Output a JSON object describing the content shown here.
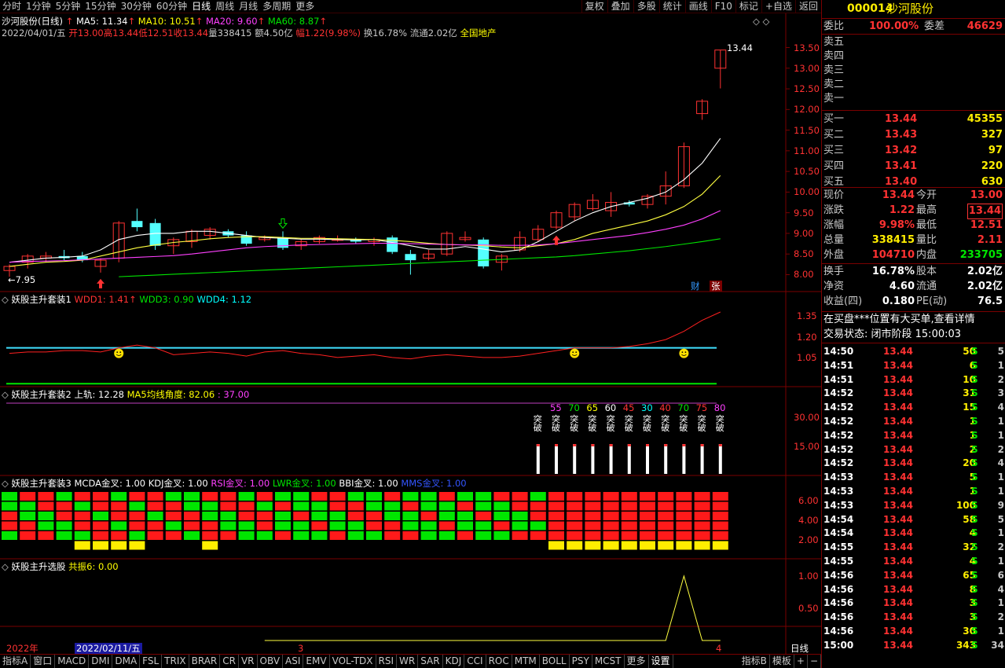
{
  "topbar": {
    "periods": [
      "分时",
      "1分钟",
      "5分钟",
      "15分钟",
      "30分钟",
      "60分钟",
      "日线",
      "周线",
      "月线",
      "多周期",
      "更多"
    ],
    "active": "日线",
    "tools": [
      "复权",
      "叠加",
      "多股",
      "统计",
      "画线",
      "F10",
      "标记",
      "+自选",
      "返回"
    ]
  },
  "main": {
    "title": "沙河股份(日线)",
    "ma5": "MA5: 11.34",
    "ma10": "MA10: 10.51",
    "ma20": "MA20: 9.60",
    "ma60": "MA60: 8.87",
    "info_date": "2022/04/01/五",
    "info_open": "开13.00",
    "info_high": "高13.44",
    "info_low": "低12.51",
    "info_close": "收13.44",
    "info_vol": "量338415",
    "info_amt": "额4.50亿",
    "info_pct": "幅1.22(9.98%)",
    "info_turn": "换16.78%",
    "info_float": "流通2.02亿",
    "info_sector": "全国地产",
    "y_ticks": [
      "13.50",
      "13.00",
      "12.50",
      "12.00",
      "11.50",
      "11.00",
      "10.50",
      "10.00",
      "9.50",
      "9.00",
      "8.50",
      "8.00"
    ],
    "high_label": "13.44",
    "low_label": "7.95",
    "badge_cai": "财",
    "badge_zhang": "张"
  },
  "chart_data": [
    {
      "type": "candlestick",
      "title": "沙河股份(日线)",
      "ylim": [
        7.8,
        13.7
      ],
      "candles": [
        {
          "o": 8.1,
          "h": 8.25,
          "l": 7.95,
          "c": 8.2
        },
        {
          "o": 8.3,
          "h": 8.5,
          "l": 8.15,
          "c": 8.45
        },
        {
          "o": 8.4,
          "h": 8.55,
          "l": 8.3,
          "c": 8.45
        },
        {
          "o": 8.45,
          "h": 8.6,
          "l": 8.35,
          "c": 8.4
        },
        {
          "o": 8.45,
          "h": 8.55,
          "l": 8.3,
          "c": 8.35
        },
        {
          "o": 8.2,
          "h": 8.4,
          "l": 8.05,
          "c": 8.35
        },
        {
          "o": 8.4,
          "h": 9.3,
          "l": 8.3,
          "c": 9.25
        },
        {
          "o": 9.3,
          "h": 9.6,
          "l": 9.05,
          "c": 9.15
        },
        {
          "o": 9.25,
          "h": 9.35,
          "l": 8.6,
          "c": 8.7
        },
        {
          "o": 8.7,
          "h": 8.9,
          "l": 8.5,
          "c": 8.85
        },
        {
          "o": 8.8,
          "h": 9.1,
          "l": 8.65,
          "c": 9.05
        },
        {
          "o": 8.95,
          "h": 9.15,
          "l": 8.85,
          "c": 9.1
        },
        {
          "o": 9.05,
          "h": 9.1,
          "l": 8.9,
          "c": 8.95
        },
        {
          "o": 8.95,
          "h": 9.05,
          "l": 8.7,
          "c": 8.75
        },
        {
          "o": 8.85,
          "h": 8.95,
          "l": 8.8,
          "c": 8.9
        },
        {
          "o": 8.9,
          "h": 9.05,
          "l": 8.6,
          "c": 8.65
        },
        {
          "o": 8.7,
          "h": 8.85,
          "l": 8.6,
          "c": 8.8
        },
        {
          "o": 8.8,
          "h": 8.95,
          "l": 8.75,
          "c": 8.9
        },
        {
          "o": 8.85,
          "h": 8.95,
          "l": 8.8,
          "c": 8.85
        },
        {
          "o": 8.85,
          "h": 8.9,
          "l": 8.75,
          "c": 8.8
        },
        {
          "o": 8.8,
          "h": 8.9,
          "l": 8.7,
          "c": 8.85
        },
        {
          "o": 8.9,
          "h": 8.95,
          "l": 8.5,
          "c": 8.55
        },
        {
          "o": 8.5,
          "h": 8.6,
          "l": 8.0,
          "c": 8.35
        },
        {
          "o": 8.4,
          "h": 8.6,
          "l": 8.35,
          "c": 8.5
        },
        {
          "o": 8.5,
          "h": 9.05,
          "l": 8.45,
          "c": 9.0
        },
        {
          "o": 8.85,
          "h": 9.05,
          "l": 8.8,
          "c": 8.9
        },
        {
          "o": 8.85,
          "h": 8.9,
          "l": 8.15,
          "c": 8.2
        },
        {
          "o": 8.3,
          "h": 8.5,
          "l": 8.1,
          "c": 8.45
        },
        {
          "o": 8.6,
          "h": 9.05,
          "l": 8.55,
          "c": 8.9
        },
        {
          "o": 8.85,
          "h": 9.2,
          "l": 8.8,
          "c": 9.1
        },
        {
          "o": 9.15,
          "h": 9.55,
          "l": 9.1,
          "c": 9.5
        },
        {
          "o": 9.4,
          "h": 9.75,
          "l": 9.3,
          "c": 9.7
        },
        {
          "o": 9.6,
          "h": 9.95,
          "l": 9.55,
          "c": 9.8
        },
        {
          "o": 9.55,
          "h": 10.0,
          "l": 9.4,
          "c": 9.75
        },
        {
          "o": 9.75,
          "h": 9.8,
          "l": 9.65,
          "c": 9.7
        },
        {
          "o": 9.7,
          "h": 9.95,
          "l": 9.6,
          "c": 9.9
        },
        {
          "o": 9.9,
          "h": 10.5,
          "l": 9.7,
          "c": 10.15
        },
        {
          "o": 10.15,
          "h": 11.2,
          "l": 10.1,
          "c": 11.1
        },
        {
          "o": 11.9,
          "h": 12.25,
          "l": 11.75,
          "c": 12.2
        },
        {
          "o": 13.0,
          "h": 13.44,
          "l": 12.51,
          "c": 13.44
        }
      ],
      "ma5": [
        8.3,
        8.35,
        8.4,
        8.42,
        8.45,
        8.6,
        8.85,
        8.95,
        9.0,
        9.0,
        9.05,
        9.05,
        9.0,
        8.95,
        8.9,
        8.88,
        8.86,
        8.86,
        8.85,
        8.84,
        8.85,
        8.78,
        8.7,
        8.62,
        8.62,
        8.68,
        8.62,
        8.55,
        8.6,
        8.8,
        9.05,
        9.3,
        9.5,
        9.65,
        9.75,
        9.85,
        10.0,
        10.3,
        10.7,
        11.3
      ],
      "ma10": [
        8.2,
        8.25,
        8.3,
        8.32,
        8.35,
        8.45,
        8.55,
        8.65,
        8.72,
        8.78,
        8.82,
        8.87,
        8.9,
        8.92,
        8.92,
        8.9,
        8.88,
        8.88,
        8.87,
        8.86,
        8.85,
        8.83,
        8.8,
        8.76,
        8.73,
        8.72,
        8.7,
        8.67,
        8.65,
        8.7,
        8.75,
        8.85,
        9.0,
        9.1,
        9.2,
        9.3,
        9.45,
        9.65,
        9.95,
        10.4
      ],
      "ma20": [
        8.3,
        8.32,
        8.33,
        8.34,
        8.36,
        8.38,
        8.4,
        8.42,
        8.44,
        8.46,
        8.5,
        8.55,
        8.6,
        8.65,
        8.68,
        8.7,
        8.72,
        8.73,
        8.74,
        8.75,
        8.76,
        8.76,
        8.75,
        8.74,
        8.73,
        8.72,
        8.72,
        8.71,
        8.71,
        8.72,
        8.75,
        8.8,
        8.85,
        8.9,
        8.95,
        9.02,
        9.1,
        9.2,
        9.35,
        9.55
      ],
      "ma60": [
        null,
        null,
        null,
        null,
        null,
        null,
        7.95,
        7.97,
        7.99,
        8.01,
        8.03,
        8.05,
        8.07,
        8.09,
        8.11,
        8.13,
        8.15,
        8.17,
        8.19,
        8.21,
        8.23,
        8.25,
        8.27,
        8.29,
        8.31,
        8.33,
        8.35,
        8.37,
        8.39,
        8.41,
        8.43,
        8.46,
        8.5,
        8.54,
        8.58,
        8.63,
        8.68,
        8.74,
        8.8,
        8.87
      ]
    },
    {
      "type": "line",
      "title": "妖股主升套装1",
      "series": [
        {
          "name": "WDD1",
          "values": [
            1.08,
            1.09,
            1.09,
            1.1,
            1.1,
            1.09,
            1.12,
            1.14,
            1.12,
            1.07,
            1.08,
            1.09,
            1.08,
            1.06,
            1.09,
            1.1,
            1.08,
            1.07,
            1.05,
            1.06,
            1.07,
            1.05,
            1.04,
            1.06,
            1.07,
            1.06,
            1.05,
            1.05,
            1.06,
            1.08,
            1.1,
            1.12,
            1.12,
            1.12,
            1.13,
            1.15,
            1.18,
            1.24,
            1.32,
            1.38
          ]
        }
      ],
      "ylim": [
        0.85,
        1.42
      ]
    }
  ],
  "ind1": {
    "title": "妖股主升套装1",
    "wdd1": "WDD1: 1.41",
    "wdd3": "WDD3: 0.90",
    "wdd4": "WDD4: 1.12",
    "y_ticks": [
      "1.35",
      "1.20",
      "1.05"
    ]
  },
  "ind2": {
    "title": "妖股主升套装2",
    "upper": "上轨: 12.28",
    "angle": "MA5均线角度: 82.06",
    "third": ": 37.00",
    "y_ticks": [
      "30.00",
      "15.00"
    ],
    "labels": [
      "55",
      "70",
      "65",
      "60",
      "45",
      "30",
      "40",
      "70",
      "75",
      "80"
    ],
    "break_text": "突破"
  },
  "ind3": {
    "title": "妖股主升套装3",
    "mcda": "MCDA金叉: 1.00",
    "kdj": "KDJ金叉: 1.00",
    "rsi": "RSI金叉: 1.00",
    "lwr": "LWR金叉: 1.00",
    "bbi": "BBI金叉: 1.00",
    "mms": "MMS金叉: 1.00",
    "y_ticks": [
      "6.00",
      "4.00",
      "2.00"
    ]
  },
  "ind4": {
    "title": "妖股主升选股",
    "gz": "共振6: 0.00",
    "y_ticks": [
      "1.00",
      "0.50"
    ]
  },
  "xaxis": {
    "year": "2022年",
    "date": "2022/02/11/五",
    "m3": "3",
    "m4": "4",
    "period": "日线"
  },
  "bottombar": {
    "tabs": [
      "指标A",
      "窗口",
      "MACD",
      "DMI",
      "DMA",
      "FSL",
      "TRIX",
      "BRAR",
      "CR",
      "VR",
      "OBV",
      "ASI",
      "EMV",
      "VOL-TDX",
      "RSI",
      "WR",
      "SAR",
      "KDJ",
      "CCI",
      "ROC",
      "MTM",
      "BOLL",
      "PSY",
      "MCST",
      "更多",
      "设置"
    ],
    "right": [
      "指标B",
      "模板",
      "+",
      "−"
    ]
  },
  "rpanel": {
    "code": "000014",
    "name": "沙河股份",
    "weibi_label": "委比",
    "weibi": "100.00%",
    "weicha_label": "委差",
    "weicha": "46629",
    "sells": [
      "卖五",
      "卖四",
      "卖三",
      "卖二",
      "卖一"
    ],
    "buys": [
      {
        "l": "买一",
        "p": "13.44",
        "v": "45355"
      },
      {
        "l": "买二",
        "p": "13.43",
        "v": "327"
      },
      {
        "l": "买三",
        "p": "13.42",
        "v": "97"
      },
      {
        "l": "买四",
        "p": "13.41",
        "v": "220"
      },
      {
        "l": "买五",
        "p": "13.40",
        "v": "630"
      }
    ],
    "stats": [
      {
        "l1": "现价",
        "v1": "13.44",
        "l2": "今开",
        "v2": "13.00"
      },
      {
        "l1": "涨跌",
        "v1": "1.22",
        "l2": "最高",
        "v2": "13.44"
      },
      {
        "l1": "涨幅",
        "v1": "9.98%",
        "l2": "最低",
        "v2": "12.51"
      },
      {
        "l1": "总量",
        "v1": "338415",
        "l2": "量比",
        "v2": "2.11"
      },
      {
        "l1": "外盘",
        "v1": "104710",
        "l2": "内盘",
        "v2": "233705"
      },
      {
        "l1": "换手",
        "v1": "16.78%",
        "l2": "股本",
        "v2": "2.02亿"
      },
      {
        "l1": "净资",
        "v1": "4.60",
        "l2": "流通",
        "v2": "2.02亿"
      },
      {
        "l1": "收益(四)",
        "v1": "0.180",
        "l2": "PE(动)",
        "v2": "76.5"
      }
    ],
    "notice": "在买盘***位置有大买单,查看详情",
    "status": "交易状态: 闭市阶段 15:00:03",
    "ticks": [
      {
        "t": "14:50",
        "p": "13.44",
        "v": "50",
        "s": "S",
        "n": "5"
      },
      {
        "t": "14:51",
        "p": "13.44",
        "v": "6",
        "s": "S",
        "n": "1"
      },
      {
        "t": "14:51",
        "p": "13.44",
        "v": "10",
        "s": "S",
        "n": "2"
      },
      {
        "t": "14:52",
        "p": "13.44",
        "v": "31",
        "s": "S",
        "n": "3"
      },
      {
        "t": "14:52",
        "p": "13.44",
        "v": "15",
        "s": "S",
        "n": "4"
      },
      {
        "t": "14:52",
        "p": "13.44",
        "v": "1",
        "s": "S",
        "n": "1"
      },
      {
        "t": "14:52",
        "p": "13.44",
        "v": "1",
        "s": "S",
        "n": "1"
      },
      {
        "t": "14:52",
        "p": "13.44",
        "v": "2",
        "s": "S",
        "n": "2"
      },
      {
        "t": "14:52",
        "p": "13.44",
        "v": "20",
        "s": "S",
        "n": "4"
      },
      {
        "t": "14:53",
        "p": "13.44",
        "v": "5",
        "s": "S",
        "n": "1"
      },
      {
        "t": "14:53",
        "p": "13.44",
        "v": "1",
        "s": "S",
        "n": "1"
      },
      {
        "t": "14:53",
        "p": "13.44",
        "v": "100",
        "s": "S",
        "n": "9"
      },
      {
        "t": "14:54",
        "p": "13.44",
        "v": "58",
        "s": "S",
        "n": "5"
      },
      {
        "t": "14:54",
        "p": "13.44",
        "v": "4",
        "s": "S",
        "n": "1"
      },
      {
        "t": "14:55",
        "p": "13.44",
        "v": "32",
        "s": "S",
        "n": "2"
      },
      {
        "t": "14:55",
        "p": "13.44",
        "v": "4",
        "s": "S",
        "n": "1"
      },
      {
        "t": "14:56",
        "p": "13.44",
        "v": "65",
        "s": "S",
        "n": "6"
      },
      {
        "t": "14:56",
        "p": "13.44",
        "v": "8",
        "s": "S",
        "n": "4"
      },
      {
        "t": "14:56",
        "p": "13.44",
        "v": "3",
        "s": "S",
        "n": "1"
      },
      {
        "t": "14:56",
        "p": "13.44",
        "v": "3",
        "s": "S",
        "n": "2"
      },
      {
        "t": "14:56",
        "p": "13.44",
        "v": "30",
        "s": "S",
        "n": "1"
      },
      {
        "t": "15:00",
        "p": "13.44",
        "v": "343",
        "s": "S",
        "n": "34"
      }
    ]
  }
}
